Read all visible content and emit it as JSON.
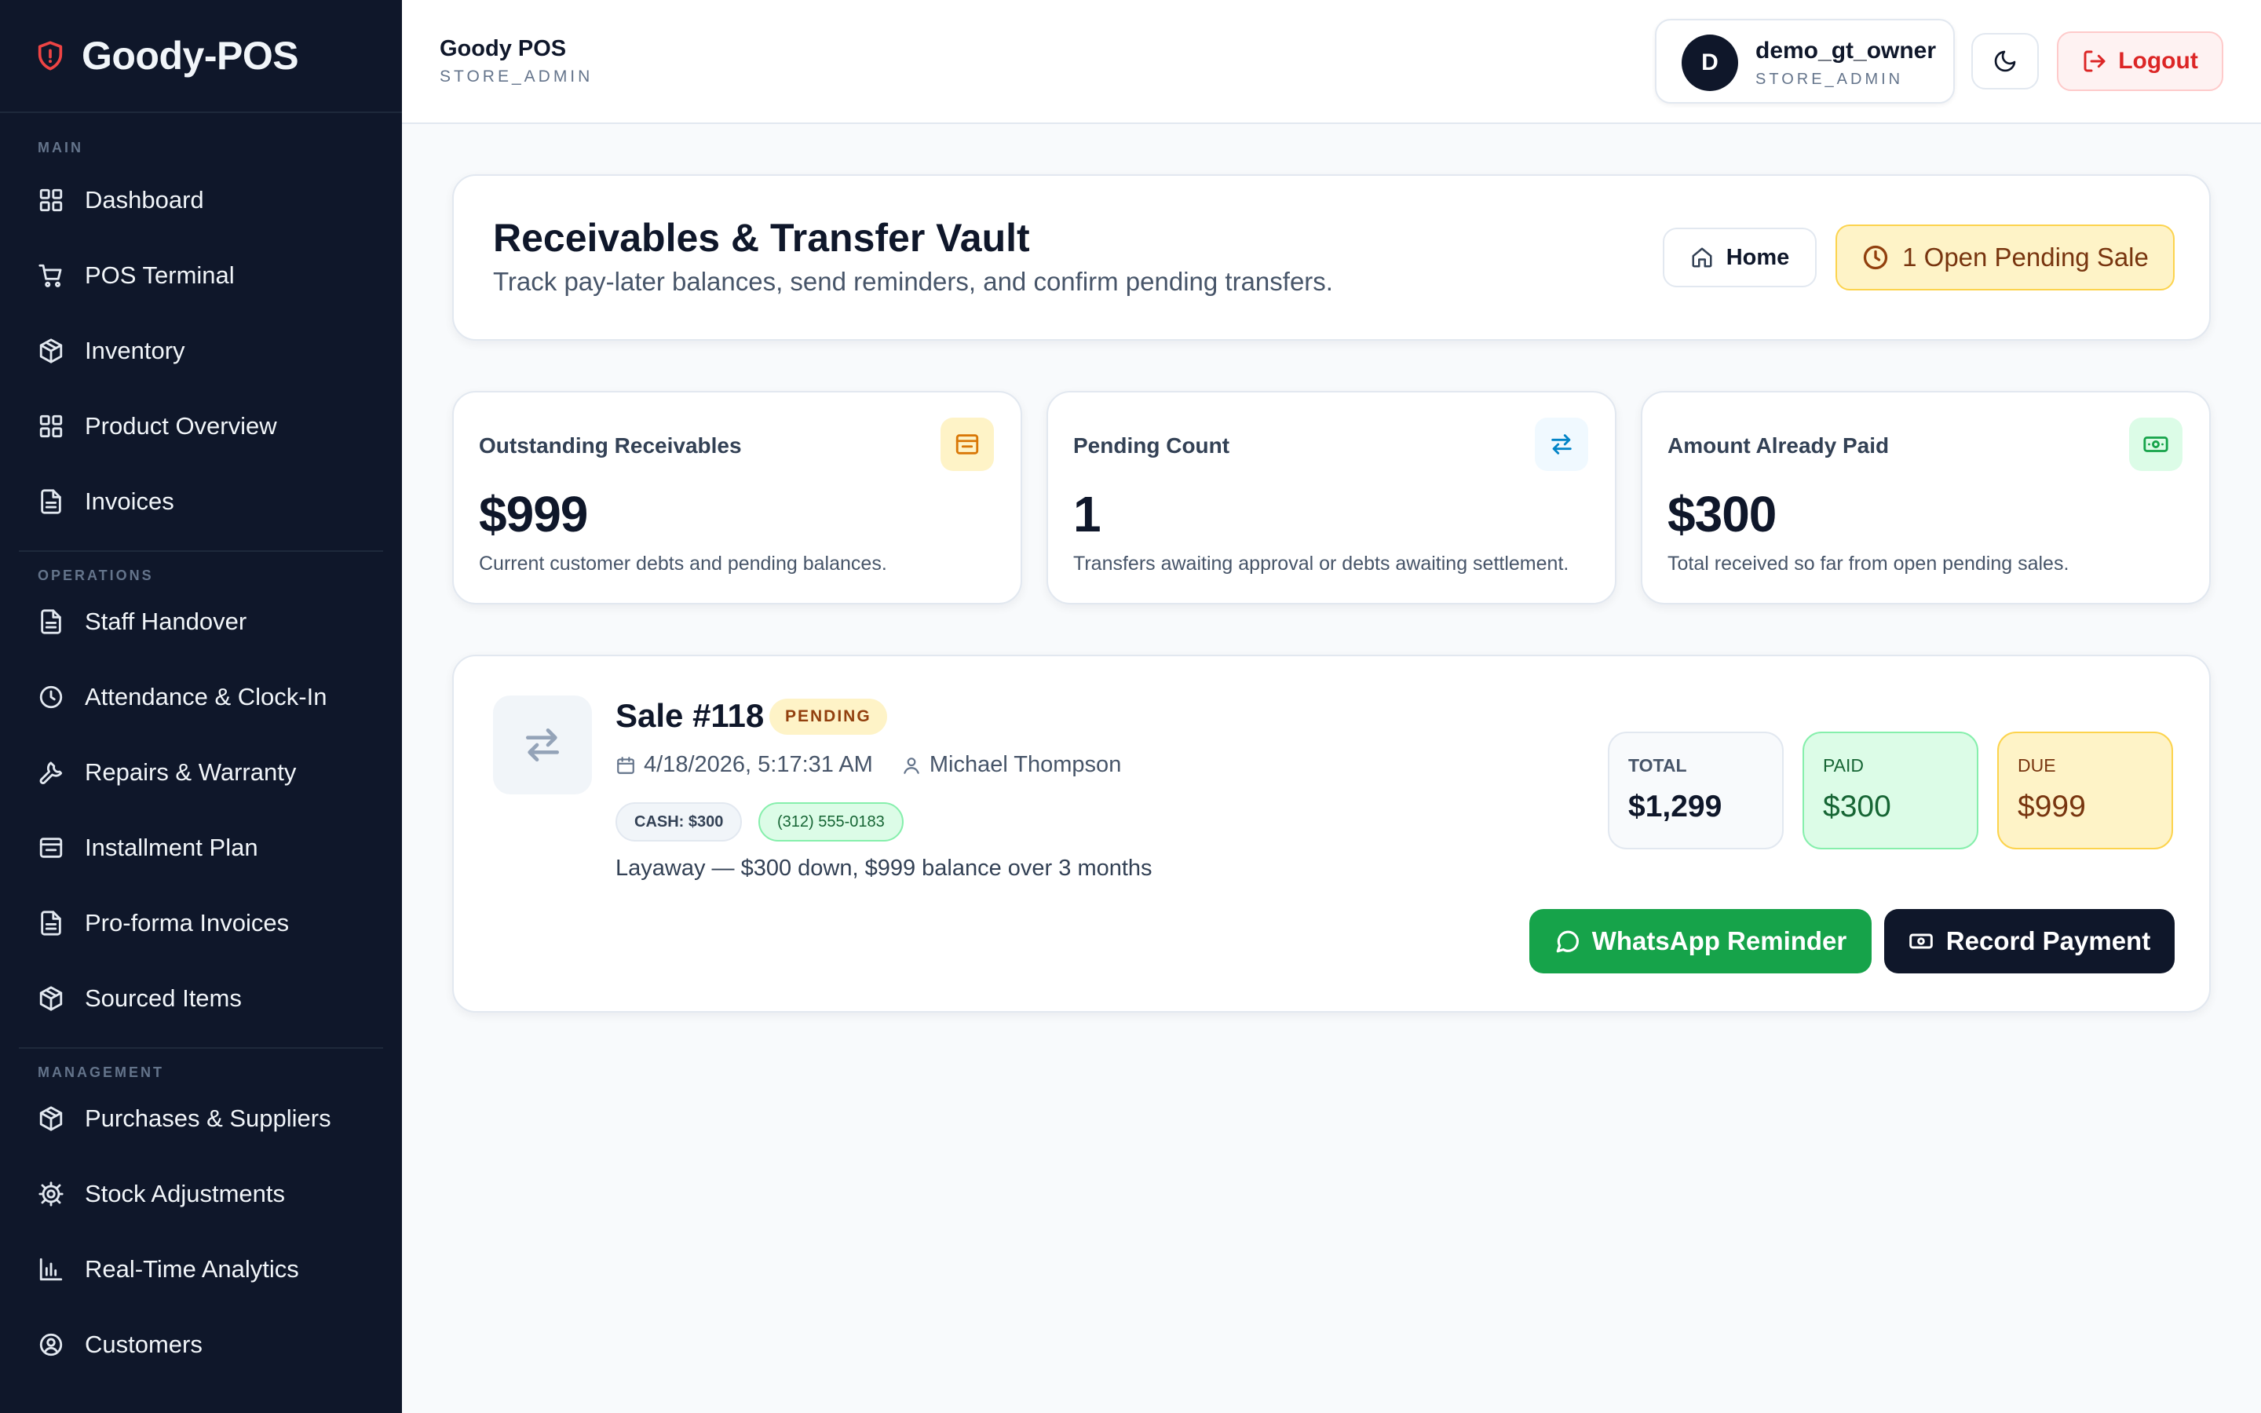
{
  "brand": {
    "name": "Goody-POS",
    "accent": "#ef4444"
  },
  "sidebar": {
    "sections": [
      {
        "title": "MAIN",
        "items": [
          {
            "label": "Dashboard",
            "icon": "grid-icon"
          },
          {
            "label": "POS Terminal",
            "icon": "cart-icon"
          },
          {
            "label": "Inventory",
            "icon": "box-icon"
          },
          {
            "label": "Product Overview",
            "icon": "grid-icon"
          },
          {
            "label": "Invoices",
            "icon": "document-icon"
          }
        ]
      },
      {
        "title": "OPERATIONS",
        "items": [
          {
            "label": "Staff Handover",
            "icon": "document-icon"
          },
          {
            "label": "Attendance & Clock-In",
            "icon": "clock-icon"
          },
          {
            "label": "Repairs & Warranty",
            "icon": "wrench-icon"
          },
          {
            "label": "Installment Plan",
            "icon": "archive-icon"
          },
          {
            "label": "Pro-forma Invoices",
            "icon": "document-icon"
          },
          {
            "label": "Sourced Items",
            "icon": "box-icon"
          }
        ]
      },
      {
        "title": "MANAGEMENT",
        "items": [
          {
            "label": "Purchases & Suppliers",
            "icon": "box-icon"
          },
          {
            "label": "Stock Adjustments",
            "icon": "gear-icon"
          },
          {
            "label": "Real-Time Analytics",
            "icon": "bar-chart-icon"
          },
          {
            "label": "Customers",
            "icon": "user-circle-icon"
          }
        ]
      }
    ]
  },
  "header": {
    "title": "Goody POS",
    "subtitle": "STORE_ADMIN",
    "user": {
      "initial": "D",
      "name": "demo_gt_owner",
      "role": "STORE_ADMIN"
    },
    "theme_icon": "moon-icon",
    "logout_label": "Logout"
  },
  "page": {
    "title": "Receivables & Transfer Vault",
    "subtitle": "Track pay-later balances, send reminders, and confirm pending transfers.",
    "home_label": "Home",
    "pending_label": "1 Open Pending Sale"
  },
  "stats": [
    {
      "label": "Outstanding Receivables",
      "value": "$999",
      "desc": "Current customer debts and pending balances.",
      "icon": "wallet-icon",
      "icon_bg": "#fef3c7",
      "icon_color": "#d97706"
    },
    {
      "label": "Pending Count",
      "value": "1",
      "desc": "Transfers awaiting approval or debts awaiting settlement.",
      "icon": "transfer-arrows-icon",
      "icon_bg": "#f0f9ff",
      "icon_color": "#0284c7"
    },
    {
      "label": "Amount Already Paid",
      "value": "$300",
      "desc": "Total received so far from open pending sales.",
      "icon": "banknote-icon",
      "icon_bg": "#dcfce7",
      "icon_color": "#16a34a"
    }
  ],
  "sale": {
    "title": "Sale #118",
    "status": "PENDING",
    "datetime": "4/18/2026, 5:17:31 AM",
    "customer": "Michael Thompson",
    "payment_chip": "CASH: $300",
    "phone_chip": "(312) 555-0183",
    "note": "Layaway — $300 down, $999 balance over 3 months",
    "total_label": "TOTAL",
    "total_value": "$1,299",
    "paid_label": "PAID",
    "paid_value": "$300",
    "due_label": "DUE",
    "due_value": "$999",
    "whatsapp_label": "WhatsApp Reminder",
    "record_label": "Record Payment"
  }
}
